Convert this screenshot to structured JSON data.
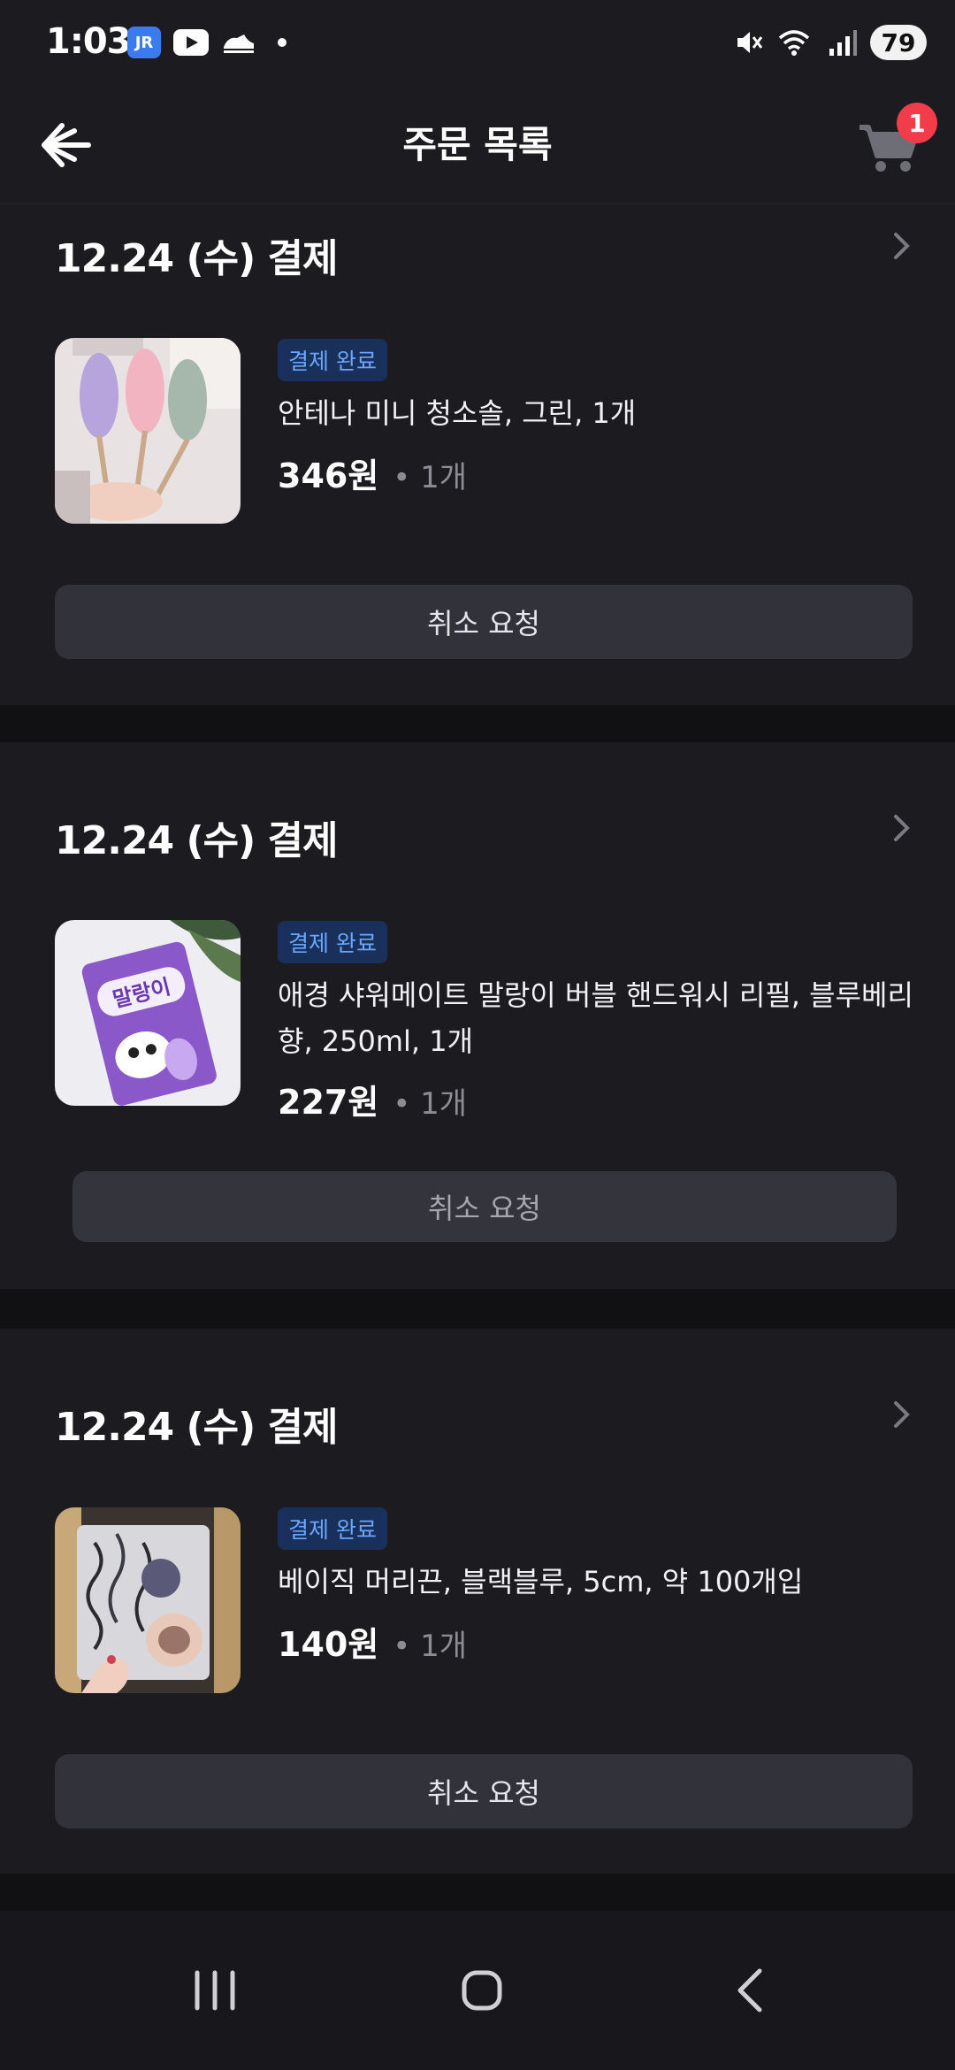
{
  "status_bar": {
    "time": "1:03",
    "app_badge": "JR",
    "battery": "79",
    "icons": [
      "mute-icon",
      "wifi-icon",
      "signal-icon",
      "battery-icon"
    ]
  },
  "header": {
    "title": "주문 목록",
    "cart_count": "1"
  },
  "orders": [
    {
      "date": "12.24 (수) 결제",
      "status": "결제 완료",
      "name": "안테나 미니 청소솔, 그린, 1개",
      "price": "346원",
      "qty": "• 1개",
      "cancel_label": "취소 요청"
    },
    {
      "date": "12.24 (수) 결제",
      "status": "결제 완료",
      "name": "애경 샤워메이트 말랑이 버블 핸드워시 리필, 블루베리향, 250ml, 1개",
      "price": "227원",
      "qty": "• 1개",
      "cancel_label": "취소 요청",
      "thumb_text": "말랑이"
    },
    {
      "date": "12.24 (수) 결제",
      "status": "결제 완료",
      "name": "베이직 머리끈, 블랙블루, 5cm, 약 100개입",
      "price": "140원",
      "qty": "• 1개",
      "cancel_label": "취소 요청"
    }
  ],
  "colors": {
    "background": "#111114",
    "card": "#1b1b20",
    "badge_bg": "#18305a",
    "badge_text": "#6aa6ff",
    "cart_badge": "#f23c4a",
    "button": "#32323a"
  }
}
